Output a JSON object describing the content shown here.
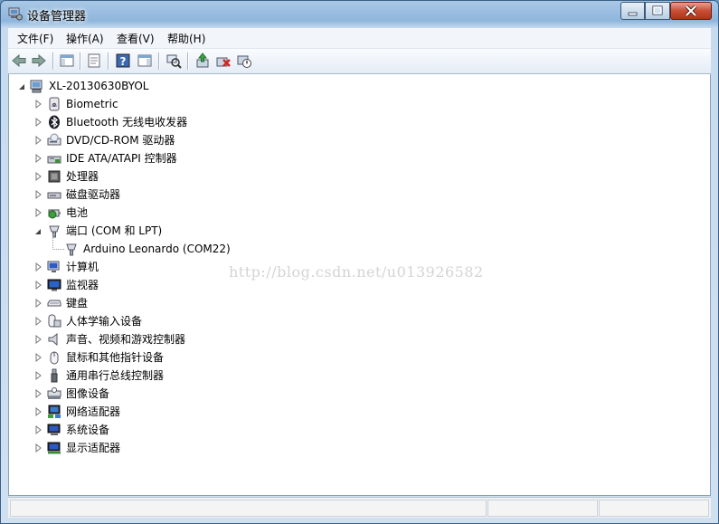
{
  "window": {
    "title": "设备管理器"
  },
  "menu": [
    {
      "label": "文件(F)"
    },
    {
      "label": "操作(A)"
    },
    {
      "label": "查看(V)"
    },
    {
      "label": "帮助(H)"
    }
  ],
  "toolbar": {
    "icons": [
      "back-arrow-icon",
      "forward-arrow-icon",
      "show-hide-console-tree-icon",
      "properties-icon",
      "help-icon",
      "show-hide-action-pane-icon",
      "scan-hardware-changes-icon",
      "update-driver-icon",
      "uninstall-icon",
      "disable-device-icon"
    ]
  },
  "tree": {
    "root": {
      "label": "XL-20130630BYOL",
      "icon": "computer-icon",
      "expanded": true
    },
    "categories": [
      {
        "label": "Biometric",
        "icon": "fingerprint-icon",
        "expanded": false
      },
      {
        "label": "Bluetooth 无线电收发器",
        "icon": "bluetooth-icon",
        "expanded": false
      },
      {
        "label": "DVD/CD-ROM 驱动器",
        "icon": "dvd-drive-icon",
        "expanded": false
      },
      {
        "label": "IDE ATA/ATAPI 控制器",
        "icon": "ide-controller-icon",
        "expanded": false
      },
      {
        "label": "处理器",
        "icon": "processor-icon",
        "expanded": false
      },
      {
        "label": "磁盘驱动器",
        "icon": "disk-drive-icon",
        "expanded": false
      },
      {
        "label": "电池",
        "icon": "battery-icon",
        "expanded": false
      },
      {
        "label": "端口 (COM 和 LPT)",
        "icon": "port-icon",
        "expanded": true,
        "children": [
          {
            "label": "Arduino Leonardo (COM22)",
            "icon": "port-icon"
          }
        ]
      },
      {
        "label": "计算机",
        "icon": "computer-icon",
        "expanded": false
      },
      {
        "label": "监视器",
        "icon": "monitor-icon",
        "expanded": false
      },
      {
        "label": "键盘",
        "icon": "keyboard-icon",
        "expanded": false
      },
      {
        "label": "人体学输入设备",
        "icon": "hid-icon",
        "expanded": false
      },
      {
        "label": "声音、视频和游戏控制器",
        "icon": "speaker-icon",
        "expanded": false
      },
      {
        "label": "鼠标和其他指针设备",
        "icon": "mouse-icon",
        "expanded": false
      },
      {
        "label": "通用串行总线控制器",
        "icon": "usb-icon",
        "expanded": false
      },
      {
        "label": "图像设备",
        "icon": "imaging-device-icon",
        "expanded": false
      },
      {
        "label": "网络适配器",
        "icon": "network-adapter-icon",
        "expanded": false
      },
      {
        "label": "系统设备",
        "icon": "system-device-icon",
        "expanded": false
      },
      {
        "label": "显示适配器",
        "icon": "display-adapter-icon",
        "expanded": false
      }
    ]
  },
  "watermark": "http://blog.csdn.net/u013926582",
  "colors": {
    "titlebar": "#8fb6dc",
    "close_button": "#c74e35",
    "tree_background": "#ffffff"
  }
}
